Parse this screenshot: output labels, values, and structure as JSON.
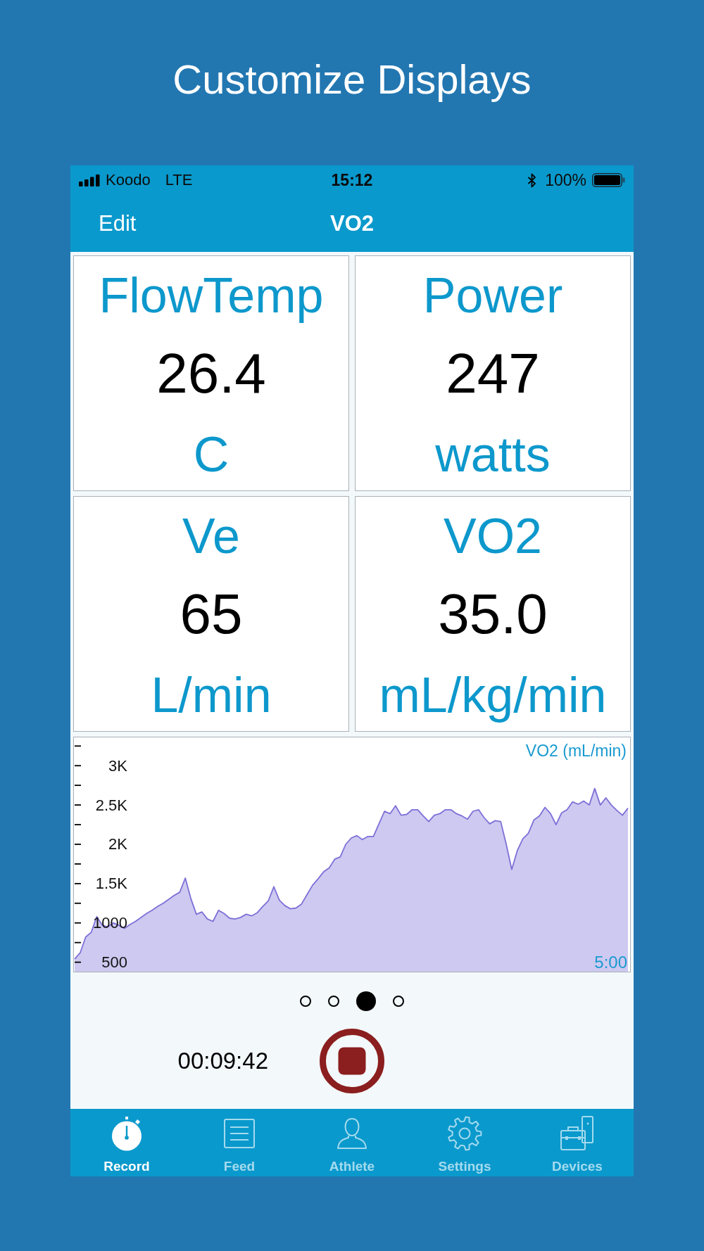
{
  "headline": "Customize Displays",
  "status_bar": {
    "carrier": "Koodo",
    "network": "LTE",
    "time": "15:12",
    "battery": "100%"
  },
  "nav_bar": {
    "left_button": "Edit",
    "title": "VO2"
  },
  "displays": [
    {
      "label": "FlowTemp",
      "value": "26.4",
      "unit": "C"
    },
    {
      "label": "Power",
      "value": "247",
      "unit": "watts"
    },
    {
      "label": "Ve",
      "value": "65",
      "unit": "L/min"
    },
    {
      "label": "VO2",
      "value": "35.0",
      "unit": "mL/kg/min"
    }
  ],
  "chart": {
    "chart_data": {
      "type": "area",
      "series": [
        {
          "name": "VO2 (mL/min)",
          "color": "#7d70d8",
          "values": [
            540,
            620,
            820,
            880,
            1080,
            970,
            950,
            1000,
            970,
            930,
            980,
            1020,
            1070,
            1120,
            1160,
            1210,
            1250,
            1300,
            1350,
            1390,
            1570,
            1310,
            1110,
            1140,
            1050,
            1020,
            1160,
            1120,
            1060,
            1050,
            1070,
            1110,
            1090,
            1130,
            1210,
            1280,
            1460,
            1290,
            1220,
            1180,
            1190,
            1240,
            1360,
            1480,
            1560,
            1650,
            1700,
            1810,
            1840,
            2000,
            2080,
            2110,
            2060,
            2100,
            2100,
            2260,
            2420,
            2390,
            2490,
            2370,
            2380,
            2440,
            2440,
            2360,
            2290,
            2370,
            2390,
            2440,
            2440,
            2390,
            2360,
            2320,
            2420,
            2440,
            2340,
            2260,
            2300,
            2290,
            2000,
            1680,
            1920,
            2070,
            2140,
            2310,
            2360,
            2470,
            2390,
            2250,
            2400,
            2440,
            2540,
            2510,
            2550,
            2500,
            2710,
            2500,
            2590,
            2500,
            2430,
            2370,
            2460
          ]
        }
      ],
      "ylim": [
        380,
        3360
      ],
      "yticks": [
        {
          "value": 500,
          "label": "500"
        },
        {
          "value": 1000,
          "label": "1000"
        },
        {
          "value": 1500,
          "label": "1.5K"
        },
        {
          "value": 2000,
          "label": "2K"
        },
        {
          "value": 2500,
          "label": "2.5K"
        },
        {
          "value": 3000,
          "label": "3K"
        }
      ],
      "annotations": [
        {
          "text": "5:00"
        }
      ]
    }
  },
  "page_dots": [
    {
      "selected": false
    },
    {
      "selected": false
    },
    {
      "selected": true
    },
    {
      "selected": false
    }
  ],
  "timer": "00:09:42",
  "tabs": [
    {
      "label": "Record",
      "selected": true
    },
    {
      "label": "Feed",
      "selected": false
    },
    {
      "label": "Athlete",
      "selected": false
    },
    {
      "label": "Settings",
      "selected": false
    },
    {
      "label": "Devices",
      "selected": false
    }
  ]
}
